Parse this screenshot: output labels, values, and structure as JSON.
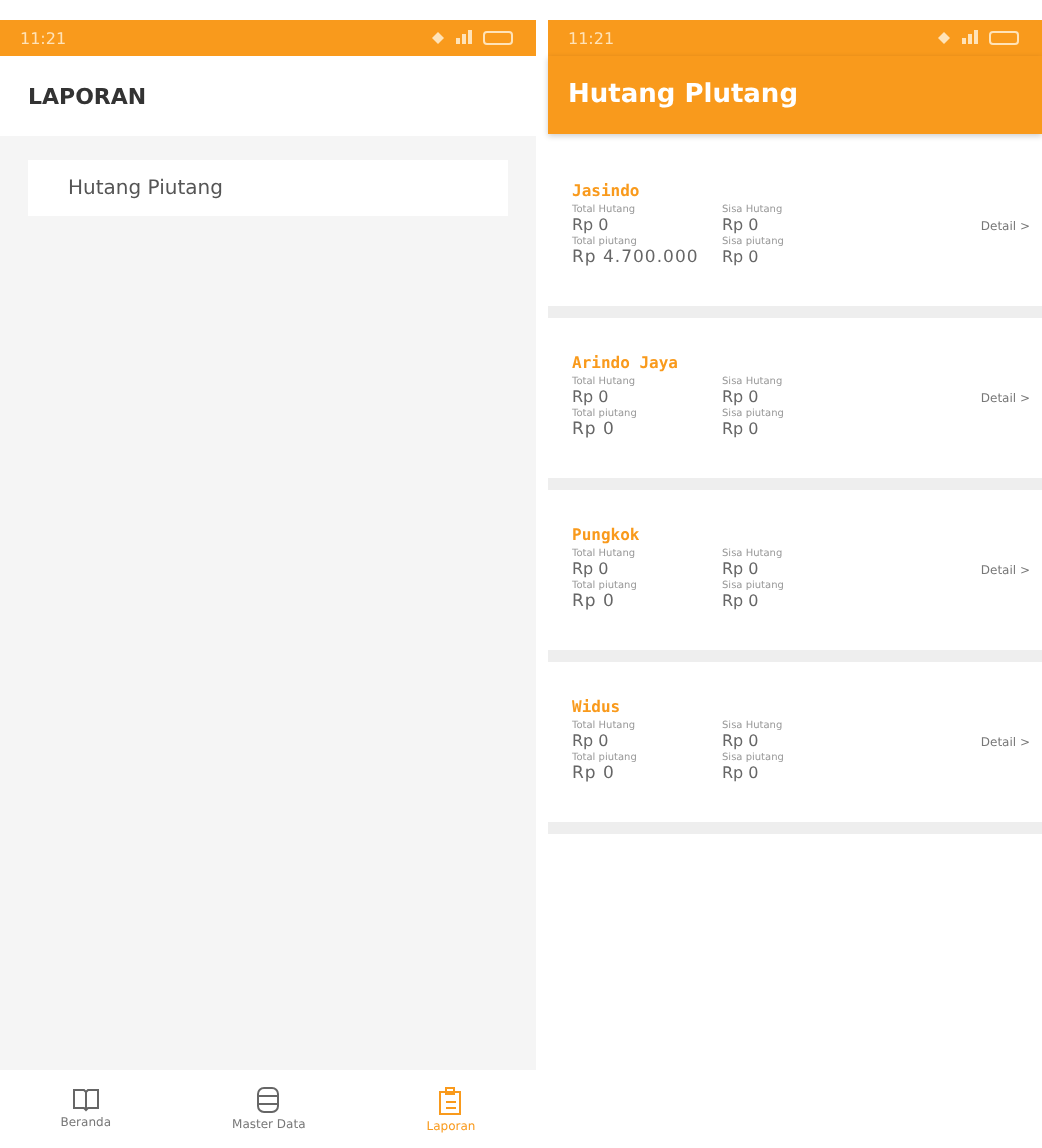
{
  "left_screen": {
    "status_bar": {
      "time": "11:21"
    },
    "title": "LAPORAN",
    "menu_items": [
      {
        "label": "Hutang Piutang"
      }
    ],
    "bottom_nav": [
      {
        "label": "Beranda",
        "selected": false
      },
      {
        "label": "Master Data",
        "selected": false
      },
      {
        "label": "Laporan",
        "selected": true
      }
    ]
  },
  "right_screen": {
    "status_bar": {
      "time": "11:21"
    },
    "title": "Hutang Plutang",
    "cards": [
      {
        "name": "Jasindo",
        "total_hutang_label": "Total Hutang",
        "total_hutang": "Rp 0",
        "sisa_hutang_label": "Sisa Hutang",
        "sisa_hutang": "Rp 0",
        "total_piutang_label": "Total piutang",
        "total_piutang": "Rp 4.700.000",
        "sisa_piutang_label": "Sisa piutang",
        "sisa_piutang": "Rp 0",
        "detail": "Detail >"
      },
      {
        "name": "Arindo Jaya",
        "total_hutang_label": "Total Hutang",
        "total_hutang": "Rp 0",
        "sisa_hutang_label": "Sisa Hutang",
        "sisa_hutang": "Rp 0",
        "total_piutang_label": "Total piutang",
        "total_piutang": "Rp 0",
        "sisa_piutang_label": "Sisa piutang",
        "sisa_piutang": "Rp 0",
        "detail": "Detail >"
      },
      {
        "name": "Pungkok",
        "total_hutang_label": "Total Hutang",
        "total_hutang": "Rp 0",
        "sisa_hutang_label": "Sisa Hutang",
        "sisa_hutang": "Rp 0",
        "total_piutang_label": "Total piutang",
        "total_piutang": "Rp 0",
        "sisa_piutang_label": "Sisa piutang",
        "sisa_piutang": "Rp 0",
        "detail": "Detail >"
      },
      {
        "name": "Widus",
        "total_hutang_label": "Total Hutang",
        "total_hutang": "Rp 0",
        "sisa_hutang_label": "Sisa Hutang",
        "sisa_hutang": "Rp 0",
        "total_piutang_label": "Total piutang",
        "total_piutang": "Rp 0",
        "sisa_piutang_label": "Sisa piutang",
        "sisa_piutang": "Rp 0",
        "detail": "Detail >"
      }
    ]
  }
}
